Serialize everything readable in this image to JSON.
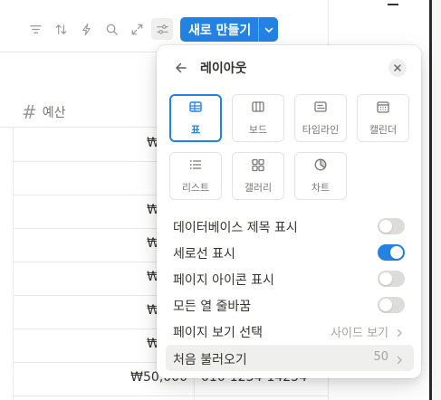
{
  "toolbar": {
    "icons": [
      "filter-icon",
      "sort-icon",
      "automation-icon",
      "search-icon",
      "expand-icon",
      "settings-sliders-icon"
    ],
    "new_button_label": "새로 만들기"
  },
  "table": {
    "column_header": "예산",
    "column_type_symbol": "#",
    "cells": [
      "₩",
      "",
      "₩",
      "₩",
      "₩",
      "₩",
      "₩",
      "₩50,000"
    ],
    "phone_cell": "010-1234-14254"
  },
  "popover": {
    "title": "레이아웃",
    "layouts": [
      {
        "label": "표",
        "icon": "table-icon",
        "selected": true
      },
      {
        "label": "보드",
        "icon": "board-icon",
        "selected": false
      },
      {
        "label": "타임라인",
        "icon": "timeline-icon",
        "selected": false
      },
      {
        "label": "캘린더",
        "icon": "calendar-icon",
        "selected": false
      },
      {
        "label": "리스트",
        "icon": "list-icon",
        "selected": false
      },
      {
        "label": "갤러리",
        "icon": "gallery-icon",
        "selected": false
      },
      {
        "label": "차트",
        "icon": "chart-icon",
        "selected": false
      }
    ],
    "options": [
      {
        "label": "데이터베이스 제목 표시",
        "type": "toggle",
        "on": false
      },
      {
        "label": "세로선 표시",
        "type": "toggle",
        "on": true
      },
      {
        "label": "페이지 아이콘 표시",
        "type": "toggle",
        "on": false
      },
      {
        "label": "모든 열 줄바꿈",
        "type": "toggle",
        "on": false
      },
      {
        "label": "페이지 보기 선택",
        "type": "select",
        "value": "사이드 보기"
      },
      {
        "label": "처음 불러오기",
        "type": "select",
        "value": "50"
      }
    ]
  },
  "colors": {
    "accent": "#2383e2",
    "toggle_off": "#dcdcda",
    "text": "#37352f",
    "muted": "#a5a4a0"
  }
}
